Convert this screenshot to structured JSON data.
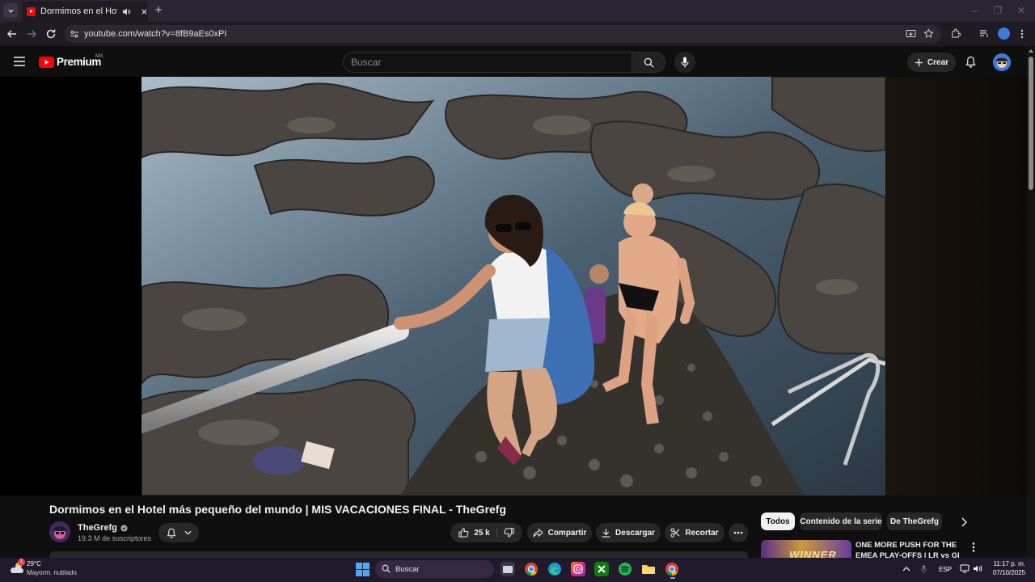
{
  "browser": {
    "tab_title": "Dormimos en el Hotel más pequeño del mundo | MIS VACACIONES FINAL - TheGrefg - YouTube",
    "url": "youtube.com/watch?v=8fB9aEs0xPI",
    "new_tab_glyph": "+"
  },
  "youtube": {
    "logo_text": "Premium",
    "region_badge": "MX",
    "search_placeholder": "Buscar",
    "create_label": "Crear"
  },
  "video": {
    "title": "Dormimos en el Hotel más pequeño del mundo | MIS VACACIONES FINAL - TheGrefg",
    "channel_name": "TheGrefg",
    "subscribers": "19.3 M de suscriptores",
    "likes": "25 k",
    "share_label": "Compartir",
    "download_label": "Descargar",
    "clip_label": "Recortar"
  },
  "recommendations": {
    "chips": [
      "Todos",
      "Contenido de la serie",
      "De TheGrefg"
    ],
    "first_title": "ONE MORE PUSH FOR THE EMEA PLAY-OFFS | LR vs GI",
    "first_thumb_text": "WINNER"
  },
  "taskbar": {
    "temperature": "29°C",
    "weather": "Mayorm. nublado",
    "search_label": "Buscar",
    "language": "ESP",
    "time": "11:17 p. m.",
    "date": "07/10/2025",
    "badge_temp": "1"
  },
  "colors": {
    "youtube_red": "#ff0000",
    "page_bg": "#0f0f0f",
    "chip_active_bg": "#f1f1f1"
  }
}
